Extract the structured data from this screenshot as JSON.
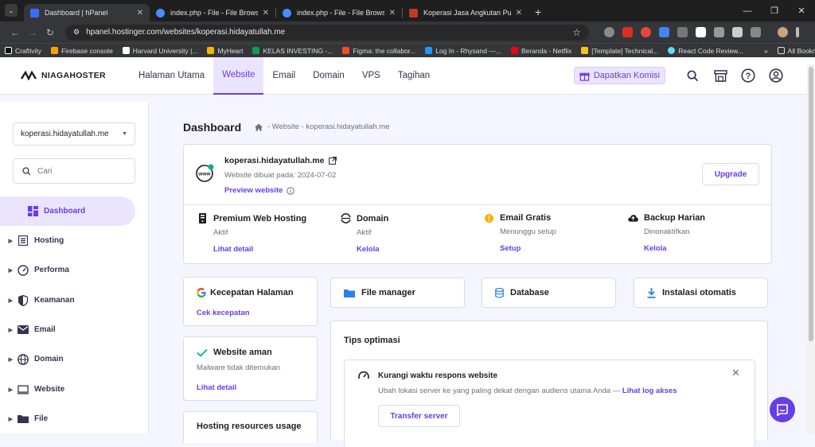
{
  "browser": {
    "tabs": [
      {
        "title": "Dashboard | hPanel",
        "active": true,
        "favicon_color": "#3d6bff"
      },
      {
        "title": "index.php - File - File Browser",
        "active": false,
        "favicon_color": "#4a8cff"
      },
      {
        "title": "index.php - File - File Browser",
        "active": false,
        "favicon_color": "#4a8cff"
      },
      {
        "title": "Koperasi Jasa Angkutan Putra M",
        "active": false,
        "favicon_color": "#c0392b"
      }
    ],
    "url": "hpanel.hostinger.com/websites/koperasi.hidayatullah.me",
    "bookmarks": [
      "Craftivity",
      "Firebase console",
      "Harvard University |...",
      "MyHeart",
      "KELAS INVESTING -...",
      "Figma: the collabor...",
      "Log In - Rhysand —...",
      "Beranda - Netflix",
      "[Template] Technical...",
      "React Code Review..."
    ],
    "all_bookmarks": "All Bookmarks"
  },
  "header": {
    "brand": "NIAGAHOSTER",
    "nav": [
      "Halaman Utama",
      "Website",
      "Email",
      "Domain",
      "VPS",
      "Tagihan"
    ],
    "active_nav": "Website",
    "komisi_label": "Dapatkan Komisi"
  },
  "sidebar": {
    "site_select": "koperasi.hidayatullah.me",
    "search_placeholder": "Cari",
    "items": [
      {
        "label": "Dashboard",
        "icon": "dashboard-icon",
        "active": true
      },
      {
        "label": "Hosting",
        "icon": "hosting-icon"
      },
      {
        "label": "Performa",
        "icon": "gauge-icon"
      },
      {
        "label": "Keamanan",
        "icon": "shield-icon"
      },
      {
        "label": "Email",
        "icon": "mail-icon"
      },
      {
        "label": "Domain",
        "icon": "globe-icon"
      },
      {
        "label": "Website",
        "icon": "monitor-icon"
      },
      {
        "label": "File",
        "icon": "folder-icon"
      }
    ]
  },
  "main": {
    "title": "Dashboard",
    "breadcrumb": "- Website - koperasi.hidayatullah.me",
    "site": {
      "domain": "koperasi.hidayatullah.me",
      "created": "Website dibuat pada: 2024-07-02",
      "preview": "Preview website",
      "upgrade": "Upgrade"
    },
    "services": [
      {
        "title": "Premium Web Hosting",
        "status": "Aktif",
        "link": "Lihat detail",
        "icon": "server-icon"
      },
      {
        "title": "Domain",
        "status": "Aktif",
        "link": "Kelola",
        "icon": "domain-icon"
      },
      {
        "title": "Email Gratis",
        "status": "Menunggu setup",
        "link": "Setup",
        "icon": "warning-icon"
      },
      {
        "title": "Backup Harian",
        "status": "Dinonaktifkan",
        "link": "Kelola",
        "icon": "cloud-icon"
      }
    ],
    "speed": {
      "title": "Kecepatan Halaman",
      "link": "Cek kecepatan"
    },
    "secure": {
      "title": "Website aman",
      "desc": "Malware tidak ditemukan",
      "link": "Lihat detail"
    },
    "resources_title": "Hosting resources usage",
    "quick": [
      "File manager",
      "Database",
      "Instalasi otomatis"
    ],
    "tips": {
      "title": "Tips optimasi",
      "item_title": "Kurangi waktu respons website",
      "item_desc": "Ubah lokasi server ke yang paling dekat dengan audiens utama Anda —",
      "item_link": "Lihat log akses",
      "button": "Transfer server"
    }
  },
  "colors": {
    "accent": "#673de6",
    "accent_bg": "#ebe4ff",
    "success": "#00b090",
    "warning": "#ffb000"
  }
}
